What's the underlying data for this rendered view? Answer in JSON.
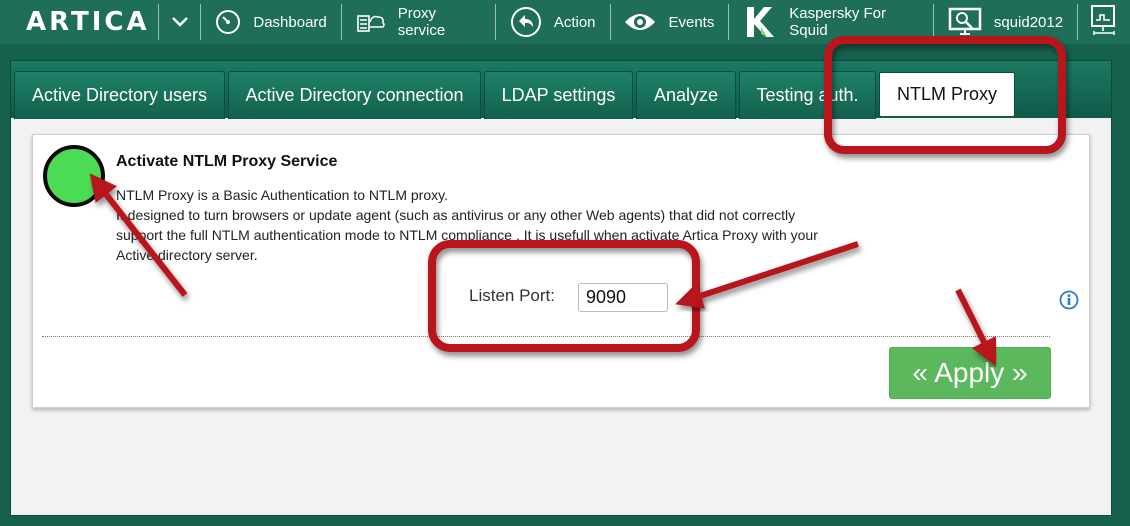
{
  "header": {
    "logo": "ARTICA",
    "nav": [
      {
        "label": "Dashboard"
      },
      {
        "label": "Proxy service"
      },
      {
        "label": "Action"
      },
      {
        "label": "Events"
      },
      {
        "label": "Kaspersky For Squid"
      },
      {
        "label": "squid2012"
      }
    ]
  },
  "tabs": [
    {
      "label": "Active Directory users"
    },
    {
      "label": "Active Directory connection"
    },
    {
      "label": "LDAP settings"
    },
    {
      "label": "Analyze"
    },
    {
      "label": "Testing auth."
    },
    {
      "label": "NTLM Proxy",
      "active": true
    }
  ],
  "main": {
    "title": "Activate NTLM Proxy Service",
    "description": [
      "NTLM Proxy is a Basic Authentication to NTLM proxy.",
      "It designed to turn browsers or update agent (such as antivirus or any other Web agents) that did not correctly",
      "support the full NTLM authentication mode to NTLM compliance . It is usefull when activate Artica Proxy with your",
      "Active directory server."
    ],
    "port_label": "Listen Port:",
    "port_value": "9090",
    "apply_label": "« Apply »",
    "status_color": "#4cdb55"
  },
  "colors": {
    "topbar": "#1e6e58",
    "accent_annotation": "#c0121a",
    "apply": "#5cb85c"
  }
}
